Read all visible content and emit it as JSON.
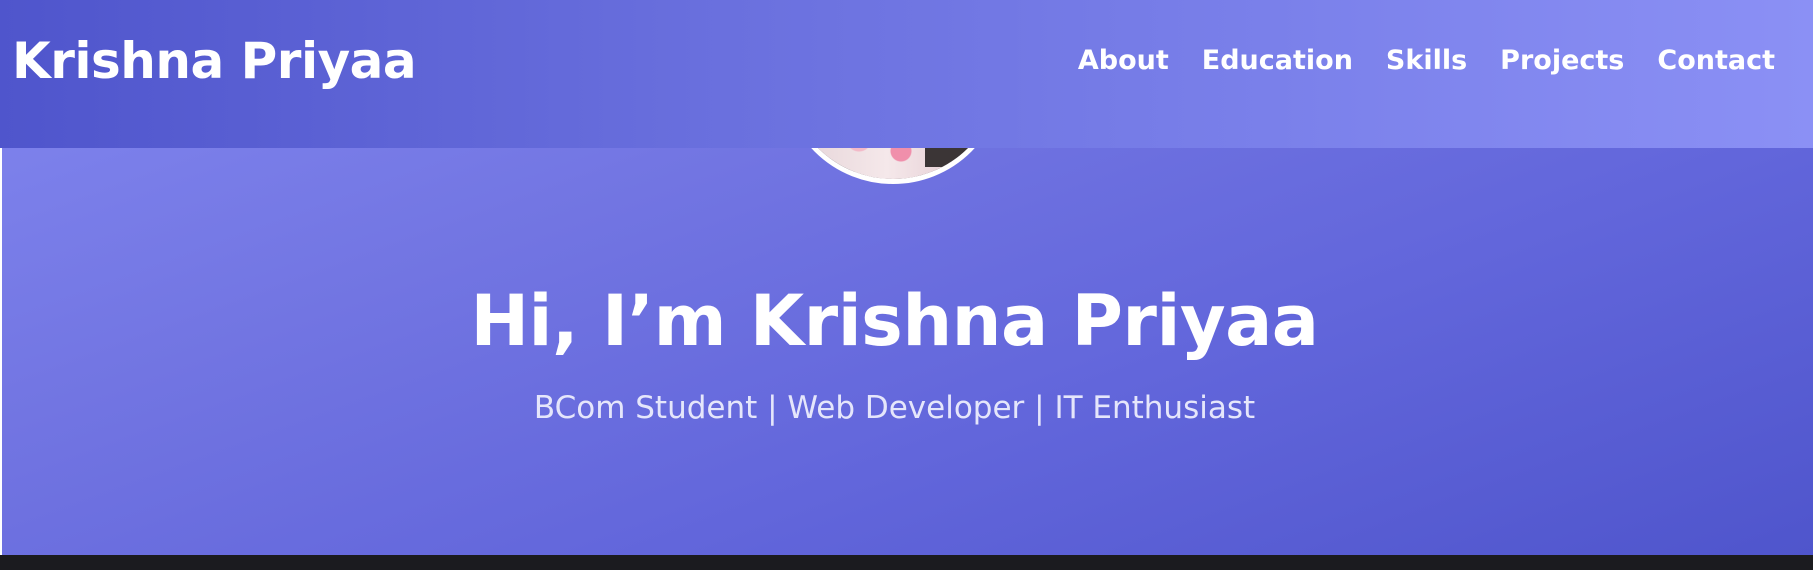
{
  "header": {
    "brand": "Krishna Priyaa",
    "nav": [
      {
        "label": "About"
      },
      {
        "label": "Education"
      },
      {
        "label": "Skills"
      },
      {
        "label": "Projects"
      },
      {
        "label": "Contact"
      }
    ]
  },
  "hero": {
    "title": "Hi, I’m Krishna Priyaa",
    "subtitle": "BCom Student | Web Developer | IT Enthusiast"
  },
  "colors": {
    "accent_dark": "#4f55cc",
    "accent_light": "#8b90f5",
    "text": "#ffffff",
    "footer": "#1b1b1f"
  }
}
